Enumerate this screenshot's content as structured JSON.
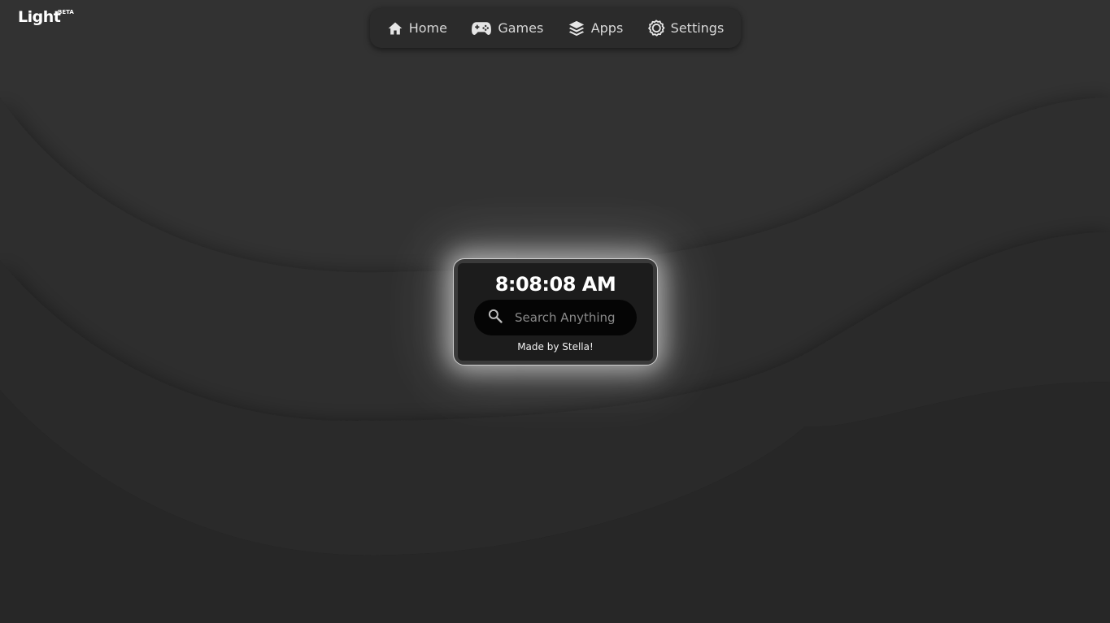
{
  "brand": {
    "name": "Light",
    "badge": "BETA"
  },
  "nav": {
    "items": [
      {
        "label": "Home",
        "icon": "home-icon"
      },
      {
        "label": "Games",
        "icon": "gamepad-icon"
      },
      {
        "label": "Apps",
        "icon": "layers-icon"
      },
      {
        "label": "Settings",
        "icon": "gear-icon"
      }
    ]
  },
  "widget": {
    "time": "8:08:08 AM",
    "search_placeholder": "Search Anything",
    "search_value": "",
    "credit": "Made by Stella!"
  },
  "colors": {
    "background": "#272727",
    "text": "#ffffff",
    "nav_bg": "#2b2b2b",
    "card_bg": "#1c1c1c",
    "search_bg": "#050505"
  }
}
